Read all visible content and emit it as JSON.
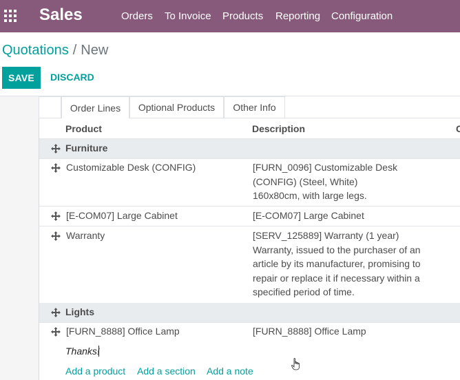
{
  "navbar": {
    "app_name": "Sales",
    "menu": [
      "Orders",
      "To Invoice",
      "Products",
      "Reporting",
      "Configuration"
    ],
    "bg_color": "#875a7b",
    "apps_icon": "grid-icon"
  },
  "breadcrumb": {
    "parent": "Quotations",
    "separator": "/",
    "current": "New"
  },
  "buttons": {
    "save": "SAVE",
    "discard": "DISCARD"
  },
  "tabs": [
    "Order Lines",
    "Optional Products",
    "Other Info"
  ],
  "active_tab": "Order Lines",
  "table": {
    "columns": [
      "Product",
      "Description",
      "C"
    ],
    "rows": [
      {
        "type": "section",
        "product": "Furniture"
      },
      {
        "type": "line",
        "product": "Customizable Desk (CONFIG)",
        "description": [
          "[FURN_0096] Customizable Desk",
          "(CONFIG) (Steel, White)",
          "160x80cm, with large legs."
        ]
      },
      {
        "type": "line",
        "product": "[E-COM07] Large Cabinet",
        "description": [
          "[E-COM07] Large Cabinet"
        ]
      },
      {
        "type": "line",
        "product": "Warranty",
        "description": [
          "[SERV_125889] Warranty (1 year)",
          "Warranty, issued to the purchaser of an",
          "article by its manufacturer, promising to",
          "repair or replace it if necessary within a",
          "specified period of time."
        ]
      },
      {
        "type": "section",
        "product": "Lights"
      },
      {
        "type": "line",
        "product": "[FURN_8888] Office Lamp",
        "description": [
          "[FURN_8888] Office Lamp"
        ]
      }
    ],
    "note_input_value": "Thanks!",
    "add_links": [
      "Add a product",
      "Add a section",
      "Add a note"
    ]
  },
  "colors": {
    "accent": "#00a09d",
    "section_bg": "#e9ecef"
  }
}
